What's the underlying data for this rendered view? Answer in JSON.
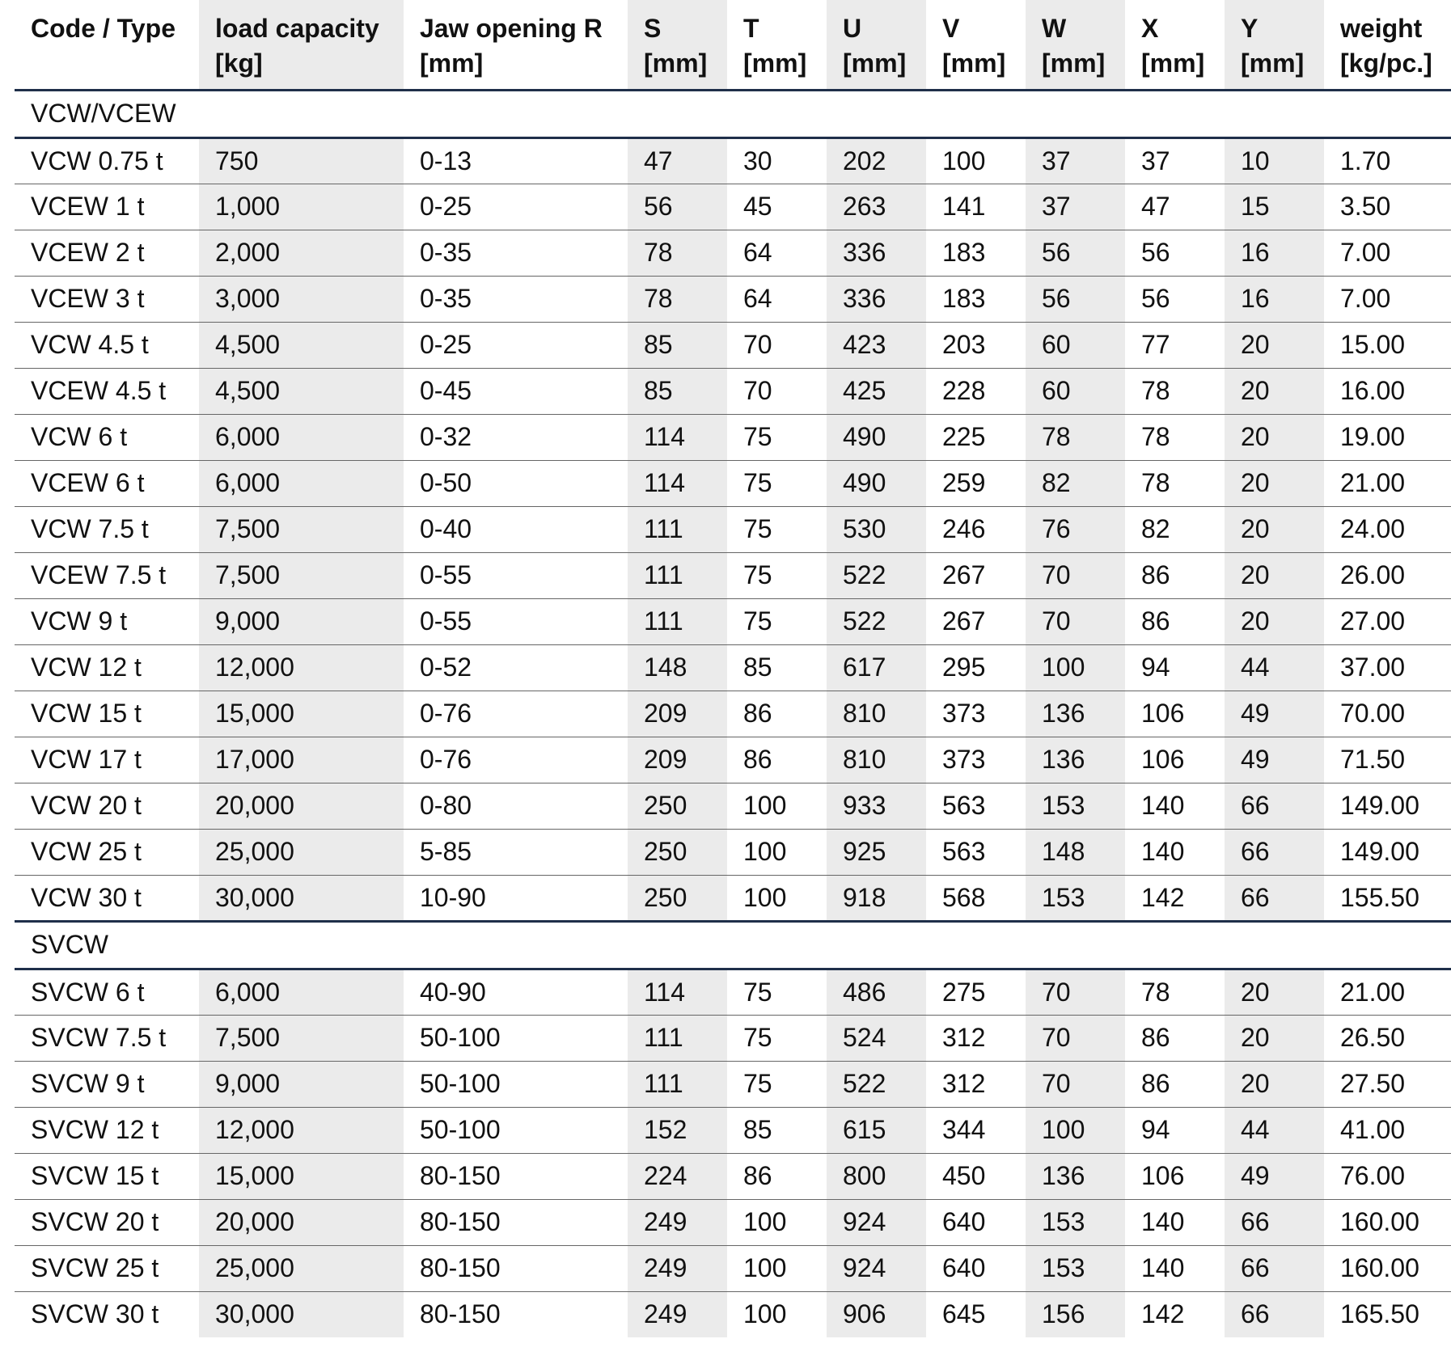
{
  "headers": [
    [
      "Code / Type",
      ""
    ],
    [
      "load capacity",
      "[kg]"
    ],
    [
      "Jaw opening R",
      "[mm]"
    ],
    [
      "S",
      "[mm]"
    ],
    [
      "T",
      "[mm]"
    ],
    [
      "U",
      "[mm]"
    ],
    [
      "V",
      "[mm]"
    ],
    [
      "W",
      "[mm]"
    ],
    [
      "X",
      "[mm]"
    ],
    [
      "Y",
      "[mm]"
    ],
    [
      "weight",
      "[kg/pc.]"
    ]
  ],
  "groups": [
    {
      "title": "VCW/VCEW",
      "rows": [
        [
          "VCW 0.75 t",
          "750",
          "0-13",
          "47",
          "30",
          "202",
          "100",
          "37",
          "37",
          "10",
          "1.70"
        ],
        [
          "VCEW 1 t",
          "1,000",
          "0-25",
          "56",
          "45",
          "263",
          "141",
          "37",
          "47",
          "15",
          "3.50"
        ],
        [
          "VCEW 2 t",
          "2,000",
          "0-35",
          "78",
          "64",
          "336",
          "183",
          "56",
          "56",
          "16",
          "7.00"
        ],
        [
          "VCEW 3 t",
          "3,000",
          "0-35",
          "78",
          "64",
          "336",
          "183",
          "56",
          "56",
          "16",
          "7.00"
        ],
        [
          "VCW 4.5 t",
          "4,500",
          "0-25",
          "85",
          "70",
          "423",
          "203",
          "60",
          "77",
          "20",
          "15.00"
        ],
        [
          "VCEW 4.5 t",
          "4,500",
          "0-45",
          "85",
          "70",
          "425",
          "228",
          "60",
          "78",
          "20",
          "16.00"
        ],
        [
          "VCW 6 t",
          "6,000",
          "0-32",
          "114",
          "75",
          "490",
          "225",
          "78",
          "78",
          "20",
          "19.00"
        ],
        [
          "VCEW 6 t",
          "6,000",
          "0-50",
          "114",
          "75",
          "490",
          "259",
          "82",
          "78",
          "20",
          "21.00"
        ],
        [
          "VCW 7.5 t",
          "7,500",
          "0-40",
          "111",
          "75",
          "530",
          "246",
          "76",
          "82",
          "20",
          "24.00"
        ],
        [
          "VCEW 7.5 t",
          "7,500",
          "0-55",
          "111",
          "75",
          "522",
          "267",
          "70",
          "86",
          "20",
          "26.00"
        ],
        [
          "VCW 9 t",
          "9,000",
          "0-55",
          "111",
          "75",
          "522",
          "267",
          "70",
          "86",
          "20",
          "27.00"
        ],
        [
          "VCW 12 t",
          "12,000",
          "0-52",
          "148",
          "85",
          "617",
          "295",
          "100",
          "94",
          "44",
          "37.00"
        ],
        [
          "VCW 15 t",
          "15,000",
          "0-76",
          "209",
          "86",
          "810",
          "373",
          "136",
          "106",
          "49",
          "70.00"
        ],
        [
          "VCW 17 t",
          "17,000",
          "0-76",
          "209",
          "86",
          "810",
          "373",
          "136",
          "106",
          "49",
          "71.50"
        ],
        [
          "VCW 20 t",
          "20,000",
          "0-80",
          "250",
          "100",
          "933",
          "563",
          "153",
          "140",
          "66",
          "149.00"
        ],
        [
          "VCW 25 t",
          "25,000",
          "5-85",
          "250",
          "100",
          "925",
          "563",
          "148",
          "140",
          "66",
          "149.00"
        ],
        [
          "VCW 30 t",
          "30,000",
          "10-90",
          "250",
          "100",
          "918",
          "568",
          "153",
          "142",
          "66",
          "155.50"
        ]
      ]
    },
    {
      "title": "SVCW",
      "rows": [
        [
          "SVCW 6 t",
          "6,000",
          "40-90",
          "114",
          "75",
          "486",
          "275",
          "70",
          "78",
          "20",
          "21.00"
        ],
        [
          "SVCW 7.5 t",
          "7,500",
          "50-100",
          "111",
          "75",
          "524",
          "312",
          "70",
          "86",
          "20",
          "26.50"
        ],
        [
          "SVCW 9 t",
          "9,000",
          "50-100",
          "111",
          "75",
          "522",
          "312",
          "70",
          "86",
          "20",
          "27.50"
        ],
        [
          "SVCW 12 t",
          "12,000",
          "50-100",
          "152",
          "85",
          "615",
          "344",
          "100",
          "94",
          "44",
          "41.00"
        ],
        [
          "SVCW 15 t",
          "15,000",
          "80-150",
          "224",
          "86",
          "800",
          "450",
          "136",
          "106",
          "49",
          "76.00"
        ],
        [
          "SVCW 20 t",
          "20,000",
          "80-150",
          "249",
          "100",
          "924",
          "640",
          "153",
          "140",
          "66",
          "160.00"
        ],
        [
          "SVCW 25 t",
          "25,000",
          "80-150",
          "249",
          "100",
          "924",
          "640",
          "153",
          "140",
          "66",
          "160.00"
        ],
        [
          "SVCW 30 t",
          "30,000",
          "80-150",
          "249",
          "100",
          "906",
          "645",
          "156",
          "142",
          "66",
          "165.50"
        ]
      ]
    }
  ]
}
